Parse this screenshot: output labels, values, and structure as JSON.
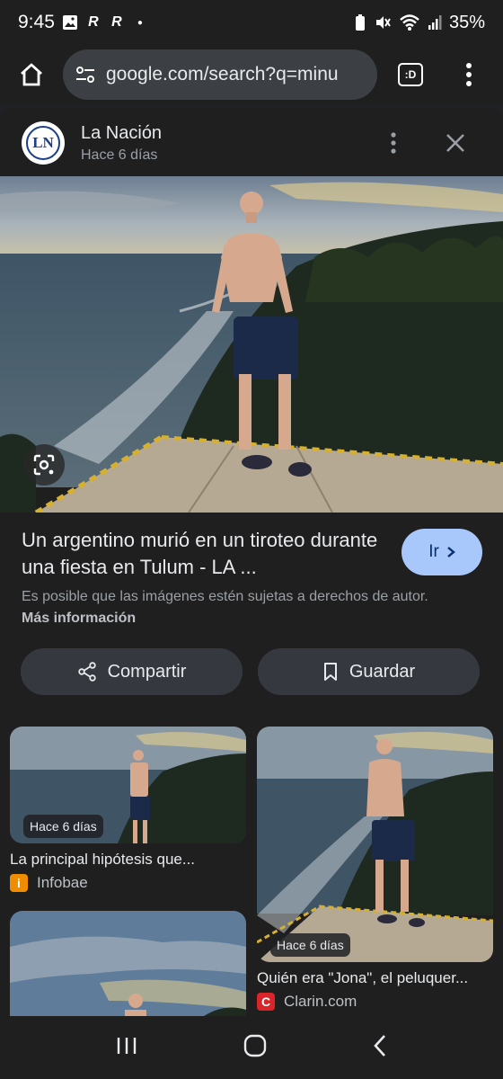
{
  "status_bar": {
    "time": "9:45",
    "battery": "35%"
  },
  "browser": {
    "url": "google.com/search?q=minu"
  },
  "source": {
    "name": "La Nación",
    "logo_text": "LN",
    "time": "Hace 6 días"
  },
  "result": {
    "title": "Un argentino murió en un tiroteo durante una fiesta en Tulum - LA ...",
    "go_label": "Ir",
    "copyright_text": "Es posible que las imágenes estén sujetas a derechos de autor.",
    "more_info_label": "Más información"
  },
  "actions": {
    "share_label": "Compartir",
    "save_label": "Guardar"
  },
  "related": [
    {
      "time": "Hace 6 días",
      "title": "La principal hipótesis que...",
      "source": "Infobae",
      "favicon_color": "#f08c00"
    },
    {
      "time": "Hace 6 días",
      "title": "Quién era \"Jona\", el peluquer...",
      "source": "Clarin.com",
      "favicon_color": "#d9252a"
    }
  ]
}
